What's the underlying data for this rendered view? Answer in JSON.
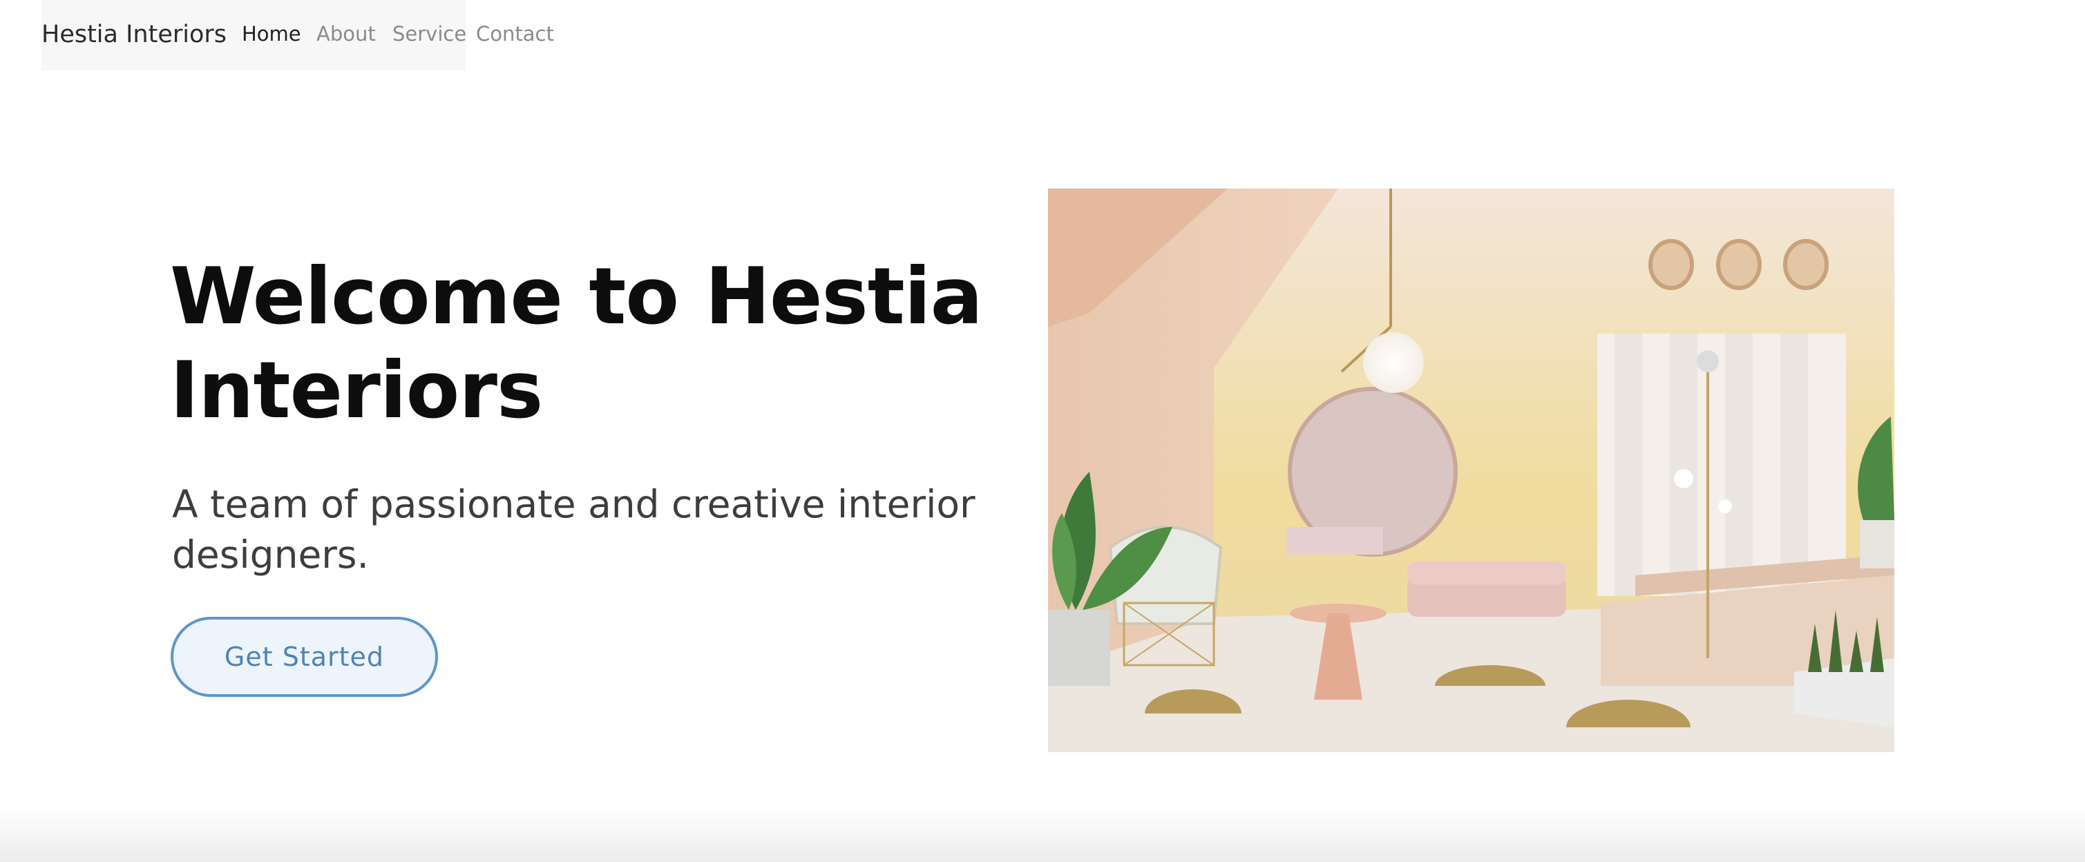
{
  "navbar": {
    "brand": "Hestia Interiors",
    "links": [
      {
        "label": "Home",
        "active": true
      },
      {
        "label": "About",
        "active": false
      },
      {
        "label": "Service",
        "active": false
      },
      {
        "label": "Contact",
        "active": false
      }
    ]
  },
  "hero": {
    "title_line1": "Welcome to Hestia",
    "title_line2": "Interiors",
    "subtitle": "A team of passionate and creative interior designers.",
    "cta_label": "Get Started",
    "image": "pastel-living-room-illustration"
  },
  "colors": {
    "accent": "#5c96c8",
    "title": "#0d0d0d",
    "subtitle": "#3d3d3d",
    "nav_bg": "#f7f7f8"
  }
}
